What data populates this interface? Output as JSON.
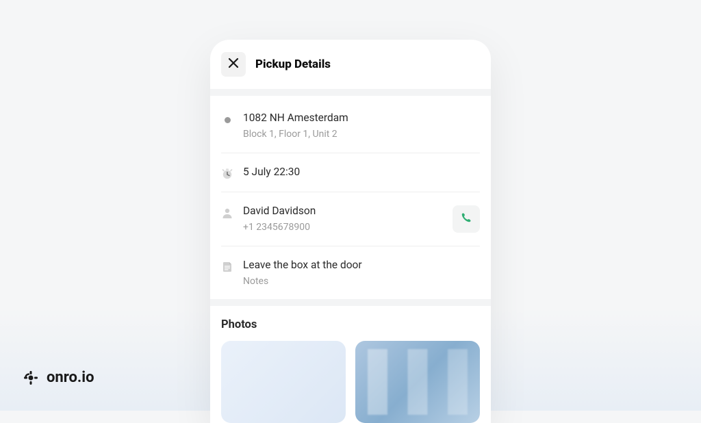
{
  "header": {
    "title": "Pickup Details"
  },
  "address": {
    "line1": "1082 NH Amesterdam",
    "line2": "Block 1, Floor 1, Unit 2"
  },
  "schedule": {
    "text": "5 July 22:30"
  },
  "contact": {
    "name": "David Davidson",
    "phone": "+1 2345678900"
  },
  "notes": {
    "text": "Leave the box at the door",
    "label": "Notes"
  },
  "photos": {
    "section_title": "Photos"
  },
  "brand": {
    "text": "onro.io"
  }
}
